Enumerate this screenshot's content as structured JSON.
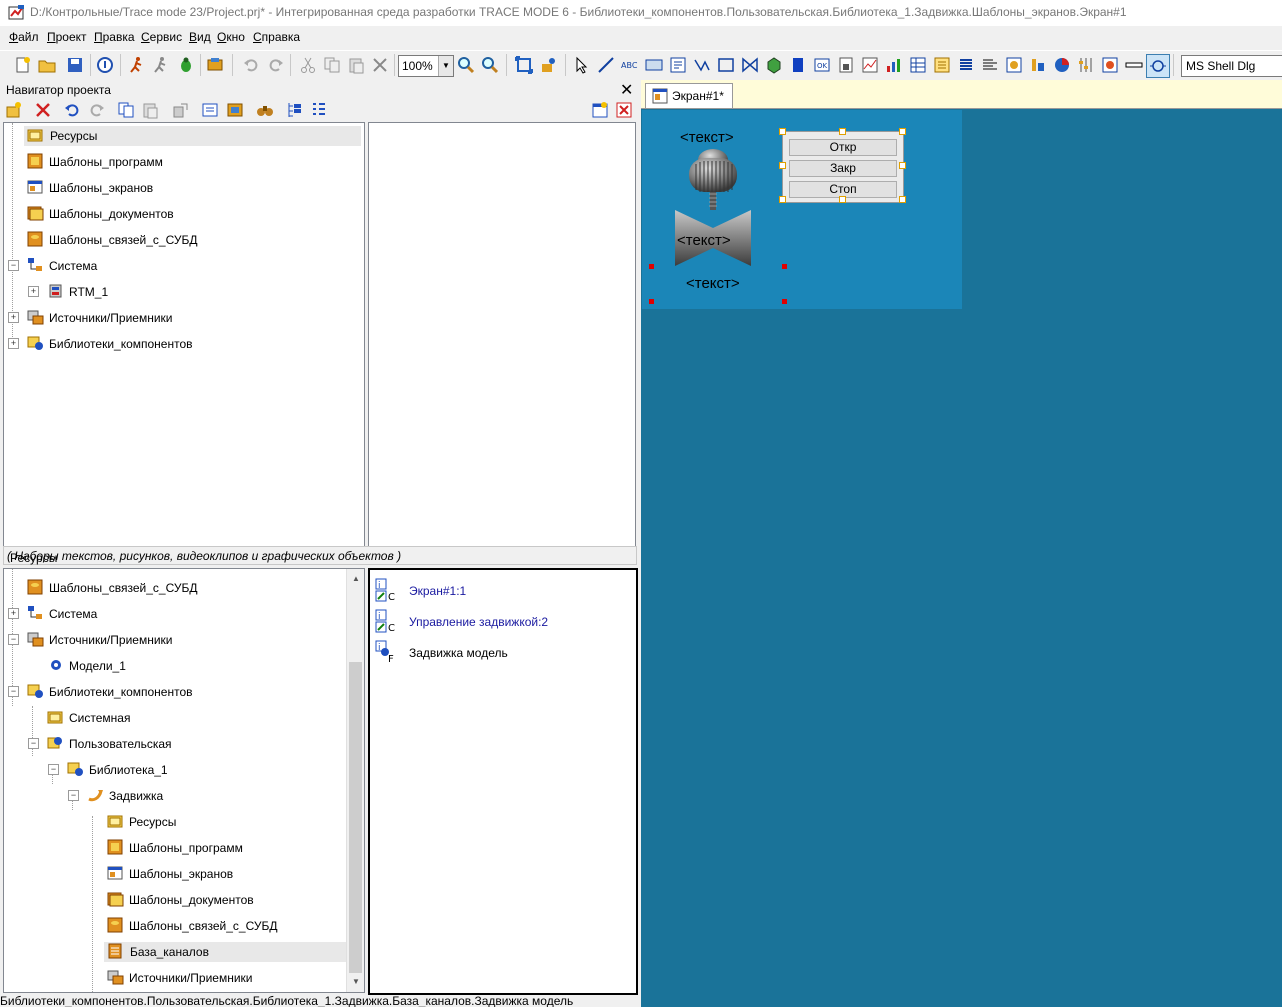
{
  "window": {
    "title": "D:/Контрольные/Trace mode 23/Project.prj* - Интегрированная среда разработки TRACE MODE 6 - Библиотеки_компонентов.Пользовательская.Библиотека_1.Задвижка.Шаблоны_экранов.Экран#1"
  },
  "menu": [
    {
      "u": "Ф",
      "rest": "айл"
    },
    {
      "u": "П",
      "rest": "роект"
    },
    {
      "u": "П",
      "rest": "равка"
    },
    {
      "u": "С",
      "rest": "ервис"
    },
    {
      "u": "В",
      "rest": "ид"
    },
    {
      "u": "О",
      "rest": "кно"
    },
    {
      "u": "С",
      "rest": "правка"
    }
  ],
  "toolbar": {
    "zoom": "100%",
    "font": "MS Shell Dlg"
  },
  "navigator": {
    "title": "Навигатор проекта",
    "close": "✕",
    "top_tree": [
      "Ресурсы",
      "Шаблоны_программ",
      "Шаблоны_экранов",
      "Шаблоны_документов",
      "Шаблоны_связей_с_СУБД",
      "Система",
      "RTM_1",
      "Источники/Приемники",
      "Библиотеки_компонентов"
    ],
    "middle_status_prefix": "Ресурсы",
    "middle_status_note": "( Наборы текстов, рисунков, видеоклипов и графических объектов )",
    "bottom_tree": [
      "Шаблоны_связей_с_СУБД",
      "Система",
      "Источники/Приемники",
      "Модели_1",
      "Библиотеки_компонентов",
      "Системная",
      "Пользовательская",
      "Библиотека_1",
      "Задвижка",
      "Ресурсы",
      "Шаблоны_программ",
      "Шаблоны_экранов",
      "Шаблоны_документов",
      "Шаблоны_связей_с_СУБД",
      "База_каналов",
      "Источники/Приемники"
    ],
    "objects": [
      {
        "label": "Экран#1:1",
        "tag": "C"
      },
      {
        "label": "Управление задвижкой:2",
        "tag": "C"
      },
      {
        "label": "Задвижка модель",
        "tag": "F"
      }
    ]
  },
  "statusbar": "Библиотеки_компонентов.Пользовательская.Библиотека_1.Задвижка.База_каналов.Задвижка модель",
  "editor": {
    "tab": "Экран#1*",
    "text_top": "<текст>",
    "text_mid": "<текст>",
    "text_bot": "<текст>",
    "buttons": [
      "Откр",
      "Закр",
      "Стоп"
    ]
  },
  "colors": {
    "canvas": "#1a7399",
    "screen_area": "#1b86b8",
    "tab_bar": "#fffcd9"
  }
}
